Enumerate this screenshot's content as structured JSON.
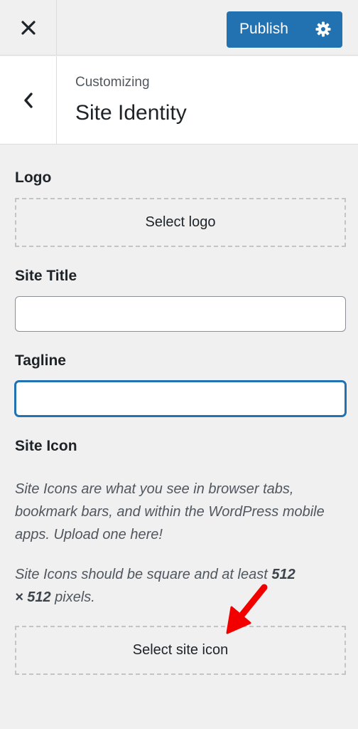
{
  "topbar": {
    "close_icon": "close-icon",
    "publish_label": "Publish",
    "settings_icon": "gear-icon",
    "accent_color": "#2271b1"
  },
  "header": {
    "back_icon": "chevron-left-icon",
    "subtitle": "Customizing",
    "title": "Site Identity"
  },
  "logo": {
    "label": "Logo",
    "button_label": "Select logo"
  },
  "site_title": {
    "label": "Site Title",
    "value": ""
  },
  "tagline": {
    "label": "Tagline",
    "value": ""
  },
  "site_icon": {
    "label": "Site Icon",
    "description": "Site Icons are what you see in browser tabs, bookmark bars, and within the WordPress mobile apps. Upload one here!",
    "size_note_prefix": "Site Icons should be square and at least ",
    "size_note_bold1": "512",
    "size_note_bold2": "× 512",
    "size_note_suffix": " pixels.",
    "button_label": "Select site icon"
  },
  "annotation": {
    "arrow_icon": "red-arrow-icon",
    "arrow_color": "#f20000"
  }
}
